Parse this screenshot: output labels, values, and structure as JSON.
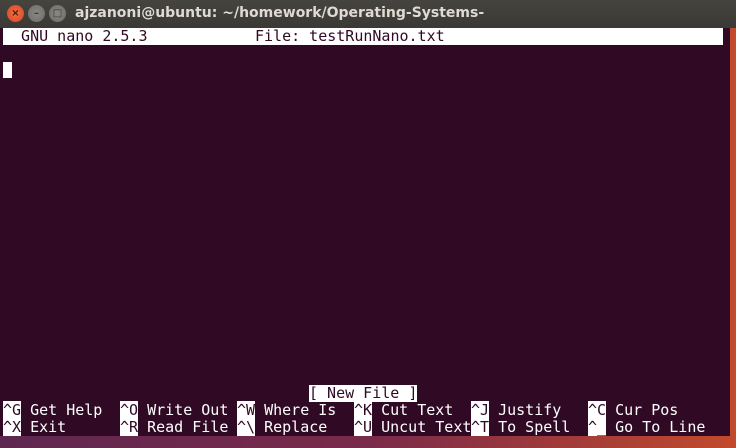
{
  "window": {
    "title": "ajzanoni@ubuntu: ~/homework/Operating-Systems-"
  },
  "colors": {
    "terminal_bg": "#300a24",
    "foreground": "#ffffff",
    "close_button": "#e95420"
  },
  "header": {
    "version": "  GNU nano 2.5.3",
    "file": "File: testRunNano.txt"
  },
  "status": "[ New File ]",
  "shortcuts": [
    [
      {
        "key": "^G",
        "label": " Get Help"
      },
      {
        "key": "^O",
        "label": " Write Out"
      },
      {
        "key": "^W",
        "label": " Where Is"
      },
      {
        "key": "^K",
        "label": " Cut Text"
      },
      {
        "key": "^J",
        "label": " Justify"
      },
      {
        "key": "^C",
        "label": " Cur Pos"
      }
    ],
    [
      {
        "key": "^X",
        "label": " Exit"
      },
      {
        "key": "^R",
        "label": " Read File"
      },
      {
        "key": "^\\",
        "label": " Replace"
      },
      {
        "key": "^U",
        "label": " Uncut Text"
      },
      {
        "key": "^T",
        "label": " To Spell"
      },
      {
        "key": "^_",
        "label": " Go To Line"
      }
    ]
  ]
}
